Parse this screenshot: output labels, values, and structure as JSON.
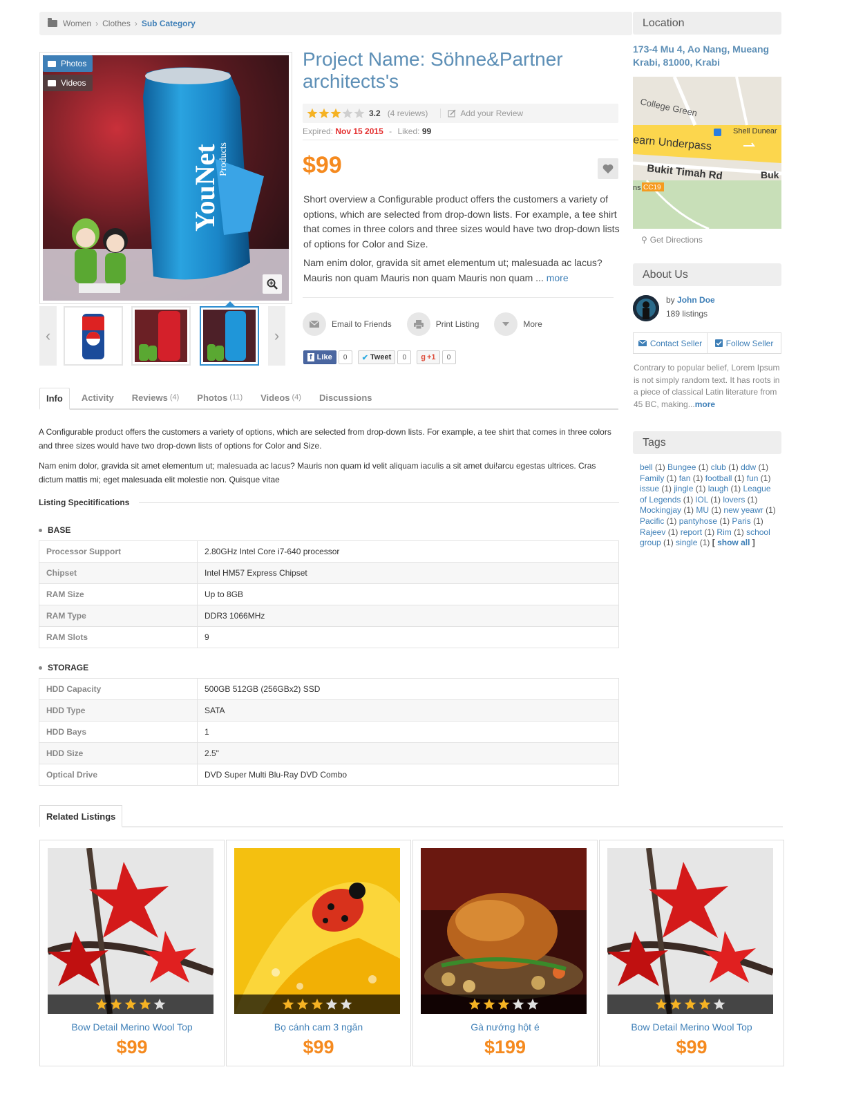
{
  "breadcrumb": {
    "items": [
      "Women",
      "Clothes"
    ],
    "current": "Sub Category"
  },
  "media_tabs": {
    "photos": "Photos",
    "videos": "Videos"
  },
  "product": {
    "title": "Project Name: Söhne&Partner architects's",
    "rating_score": "3.2",
    "rating_value": 3.2,
    "reviews": "(4 reviews)",
    "add_review": "Add your Review",
    "expired_label": "Expired:",
    "expired_date": "Nov 15 2015",
    "liked_label": "Liked:",
    "liked_count": "99",
    "price": "$99",
    "desc1": "Short overview a Configurable product offers the customers a variety of options, which are selected from drop-down lists. For example, a tee shirt that comes in three colors and three sizes would have two drop-down lists of options for Color and Size.",
    "desc2": "Nam enim dolor, gravida sit amet elementum ut; malesuada ac lacus? Mauris non quam Mauris non quam Mauris non quam ...",
    "more": "more"
  },
  "actions": {
    "email": "Email to Friends",
    "print": "Print Listing",
    "more": "More"
  },
  "social": {
    "like": "Like",
    "like_count": "0",
    "tweet": "Tweet",
    "tweet_count": "0",
    "gplus": "+1",
    "gplus_count": "0"
  },
  "tabs": [
    {
      "label": "Info",
      "count": ""
    },
    {
      "label": "Activity",
      "count": ""
    },
    {
      "label": "Reviews",
      "count": "(4)"
    },
    {
      "label": "Photos",
      "count": "(11)"
    },
    {
      "label": "Videos",
      "count": "(4)"
    },
    {
      "label": "Discussions",
      "count": ""
    }
  ],
  "info": {
    "p1": "A Configurable product offers the customers a variety of options, which are selected from drop-down lists. For example, a tee shirt that comes in three colors and three sizes would have two drop-down lists of options for Color and Size.",
    "p2": "Nam enim dolor, gravida sit amet elementum ut; malesuada ac lacus? Mauris non quam id velit aliquam iaculis a sit amet dui!arcu egestas ultrices. Cras dictum mattis mi; eget malesuada elit molestie non. Quisque vitae"
  },
  "specs": {
    "heading": "Listing Specitifications",
    "base_title": "BASE",
    "base": [
      [
        "Processor Support",
        "2.80GHz Intel Core i7-640 processor"
      ],
      [
        "Chipset",
        "Intel HM57 Express Chipset"
      ],
      [
        "RAM Size",
        "Up to 8GB"
      ],
      [
        "RAM Type",
        "DDR3 1066MHz"
      ],
      [
        "RAM Slots",
        "9"
      ]
    ],
    "storage_title": "STORAGE",
    "storage": [
      [
        "HDD Capacity",
        "500GB 512GB (256GBx2) SSD"
      ],
      [
        "HDD Type",
        "SATA"
      ],
      [
        "HDD Bays",
        "1"
      ],
      [
        "HDD Size",
        "2.5\""
      ],
      [
        "Optical Drive",
        "DVD Super Multi Blu-Ray DVD Combo"
      ]
    ]
  },
  "related": {
    "tab": "Related Listings",
    "items": [
      {
        "name": "Bow Detail Merino Wool Top",
        "price": "$99",
        "rating": 4
      },
      {
        "name": "Bọ cánh cam 3 ngăn",
        "price": "$99",
        "rating": 3
      },
      {
        "name": "Gà nướng hột é",
        "price": "$199",
        "rating": 3
      },
      {
        "name": "Bow Detail Merino Wool Top",
        "price": "$99",
        "rating": 4
      }
    ]
  },
  "sidebar": {
    "location_title": "Location",
    "address": "173-4 Mu 4, Ao Nang, Mueang Krabi, 81000, Krabi",
    "map_labels": {
      "a": "College Green",
      "b": "earn Underpass",
      "c": "Shell Dunear",
      "d": "Bukit Timah Rd",
      "e": "Buk",
      "f": "CC19",
      "g": "ns"
    },
    "get_directions": "Get Directions",
    "about_title": "About Us",
    "by": "by",
    "author": "John Doe",
    "listings": "189 listings",
    "contact": "Contact Seller",
    "follow": "Follow Seller",
    "about_text": "Contrary to popular belief, Lorem Ipsum is not simply random text. It has roots in a piece of classical Latin literature from 45 BC, making...",
    "about_more": "more",
    "tags_title": "Tags",
    "tags": [
      "bell",
      "Bungee",
      "club",
      "ddw",
      "Family",
      "fan",
      "football",
      "fun",
      "issue",
      "jingle",
      "laugh",
      "League of Legends",
      "lOL",
      "lovers",
      "Mockingjay",
      "MU",
      "new yeawr",
      "Pacific",
      "pantyhose",
      "Paris",
      "Rajeev",
      "report",
      "Rim",
      "school group",
      "single"
    ],
    "tag_count": "(1)",
    "show_all": "show all"
  },
  "colors": {
    "accent": "#3e7fb7",
    "price": "#f58a1f",
    "expired": "#e42d2d",
    "star": "#f5b223"
  }
}
